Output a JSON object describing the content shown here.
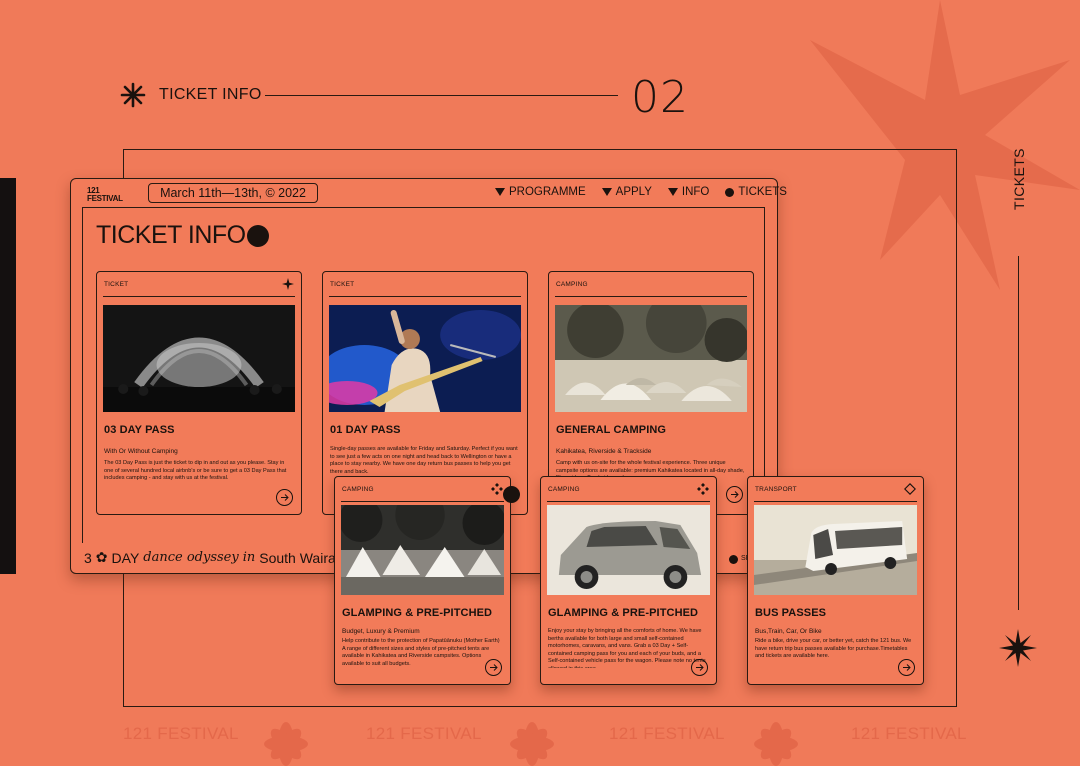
{
  "slide": {
    "title": "TICKET INFO",
    "number": "02",
    "side_label": "TICKETS",
    "ghost_text": "121 FESTIVAL"
  },
  "site": {
    "logo_line1": "121",
    "logo_line2": "FESTIVAL",
    "date": "March 11th—13th, © 2022",
    "nav": [
      {
        "label": "PROGRAMME",
        "icon": "triangle-down-icon"
      },
      {
        "label": "APPLY",
        "icon": "triangle-down-icon"
      },
      {
        "label": "INFO",
        "icon": "triangle-down-icon"
      },
      {
        "label": "TICKETS",
        "icon": "dot-icon"
      }
    ],
    "page_title": "TICKET INFO",
    "footer": {
      "num": "3",
      "day": "DAY",
      "tagline": "dance odyssey",
      "in": "in",
      "place": "South Wairarapa, Ta",
      "right_text": "SP"
    }
  },
  "cards": [
    {
      "tag": "TICKET",
      "glyph": "sparkle-icon",
      "name": "03 DAY PASS",
      "sub": "With Or Without Camping",
      "desc": "The 03 Day Pass is just the ticket to dip in and out as you please. Stay in one of several hundred local airbnb's or be sure to get a 03 Day Pass that includes camping - and stay with us at the festival."
    },
    {
      "tag": "TICKET",
      "glyph": "",
      "name": "01 DAY PASS",
      "sub": "",
      "desc": "Single-day passes are available for Friday and Saturday. Perfect if you want to see just a few acts on one night and head back to Wellington or have a place to stay nearby. We have one day return bus passes to help you get there and back."
    },
    {
      "tag": "CAMPING",
      "glyph": "",
      "name": "GENERAL CAMPING",
      "sub": "Kahikatea, Riverside & Trackside",
      "desc": "Camp with us on-site for the whole festival experience. Three unique campsite options are available: premium Kahikatea located in all-day shade, Riverside or Trackside, under our"
    },
    {
      "tag": "CAMPING",
      "glyph": "four-diamonds-icon",
      "name": "GLAMPING & PRE-PITCHED",
      "sub": "Budget, Luxury & Premium",
      "desc": "Help contribute to the protection of Papatūānuku (Mother Earth) A range of different sizes and styles of pre-pitched tents are available in Kahikatea and Riverside campsites. Options available to suit all budgets."
    },
    {
      "tag": "CAMPING",
      "glyph": "four-diamonds-icon",
      "name": "GLAMPING & PRE-PITCHED",
      "sub": "",
      "desc": "Enjoy your stay by bringing all the comforts of home. We have berths available for both large and small self-contained motorhomes, caravans, and vans. Grab a 03 Day + Self-contained camping pass for you and each of your buds, and a Self-contained vehicle pass for the wagon. Please note no tents allowed in this area."
    },
    {
      "tag": "TRANSPORT",
      "glyph": "diamond-outline-icon",
      "name": "BUS PASSES",
      "sub": "Bus,Train, Car, Or Bike",
      "desc": "Ride a bike, drive your car, or better yet, catch the 121 bus. We have return trip bus passes available for purchase.Timetables and tickets are available here."
    }
  ]
}
